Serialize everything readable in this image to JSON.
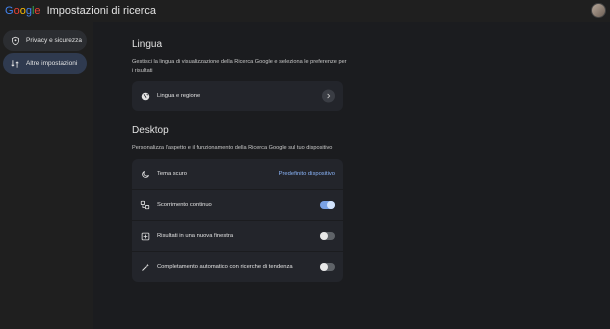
{
  "header": {
    "brand": "Google",
    "title": "Impostazioni di ricerca"
  },
  "sidebar": {
    "items": [
      {
        "label": "Privacy e sicurezza",
        "icon": "shield-icon"
      },
      {
        "label": "Altre impostazioni",
        "icon": "sliders-icon"
      }
    ]
  },
  "lingua": {
    "heading": "Lingua",
    "description": "Gestisci la lingua di visualizzazione della Ricerca Google e seleziona le preferenze per i risultati",
    "row_label": "Lingua e regione"
  },
  "desktop": {
    "heading": "Desktop",
    "description": "Personalizza l'aspetto e il funzionamento della Ricerca Google sul tuo dispositivo",
    "rows": [
      {
        "label": "Tema scuro",
        "value": "Predefinito dispositivo"
      },
      {
        "label": "Scorrimento continuo",
        "toggle": "on"
      },
      {
        "label": "Risultati in una nuova finestra",
        "toggle": "off"
      },
      {
        "label": "Completamento automatico con ricerche di tendenza",
        "toggle": "off"
      }
    ]
  },
  "colors": {
    "background": "#1b1c1f",
    "card": "#23252b",
    "accent": "#8ab4f8",
    "sidebar_active": "#2f3a4f"
  }
}
